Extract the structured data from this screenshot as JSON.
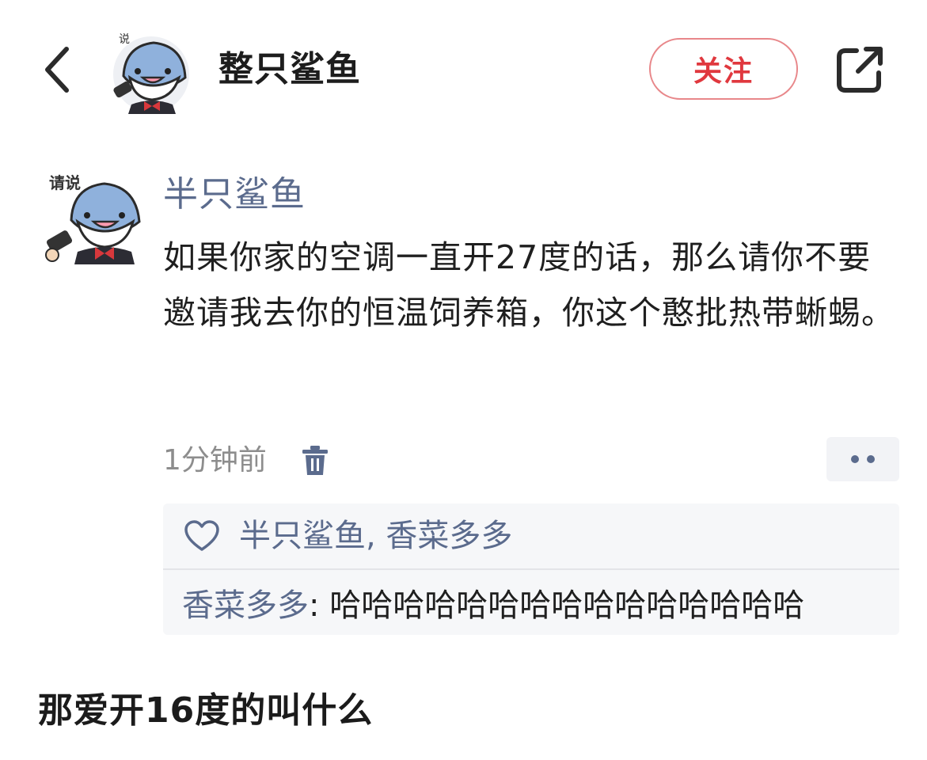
{
  "header": {
    "back_icon": "chevron-left-icon",
    "avatar_label": "说",
    "name": "整只鲨鱼",
    "follow_label": "关注",
    "share_icon": "external-link-icon"
  },
  "post": {
    "avatar_label": "请说",
    "author": "半只鲨鱼",
    "text": "如果你家的空调一直开27度的话，那么请你不要邀请我去你的恒温饲养箱，你这个憨批热带蜥蜴。",
    "time": "1分钟前",
    "delete_icon": "trash-icon",
    "more_icon": "more-dots-icon"
  },
  "interactions": {
    "like_icon": "heart-icon",
    "likes": "半只鲨鱼, 香菜多多",
    "comments": [
      {
        "author": "香菜多多",
        "separator": ": ",
        "text": "哈哈哈哈哈哈哈哈哈哈哈哈哈哈哈"
      }
    ]
  },
  "caption": "那爱开16度的叫什么",
  "colors": {
    "accent_red": "#e0383e",
    "link_blue_gray": "#5b6b8d",
    "panel_bg": "#f6f7f9"
  }
}
